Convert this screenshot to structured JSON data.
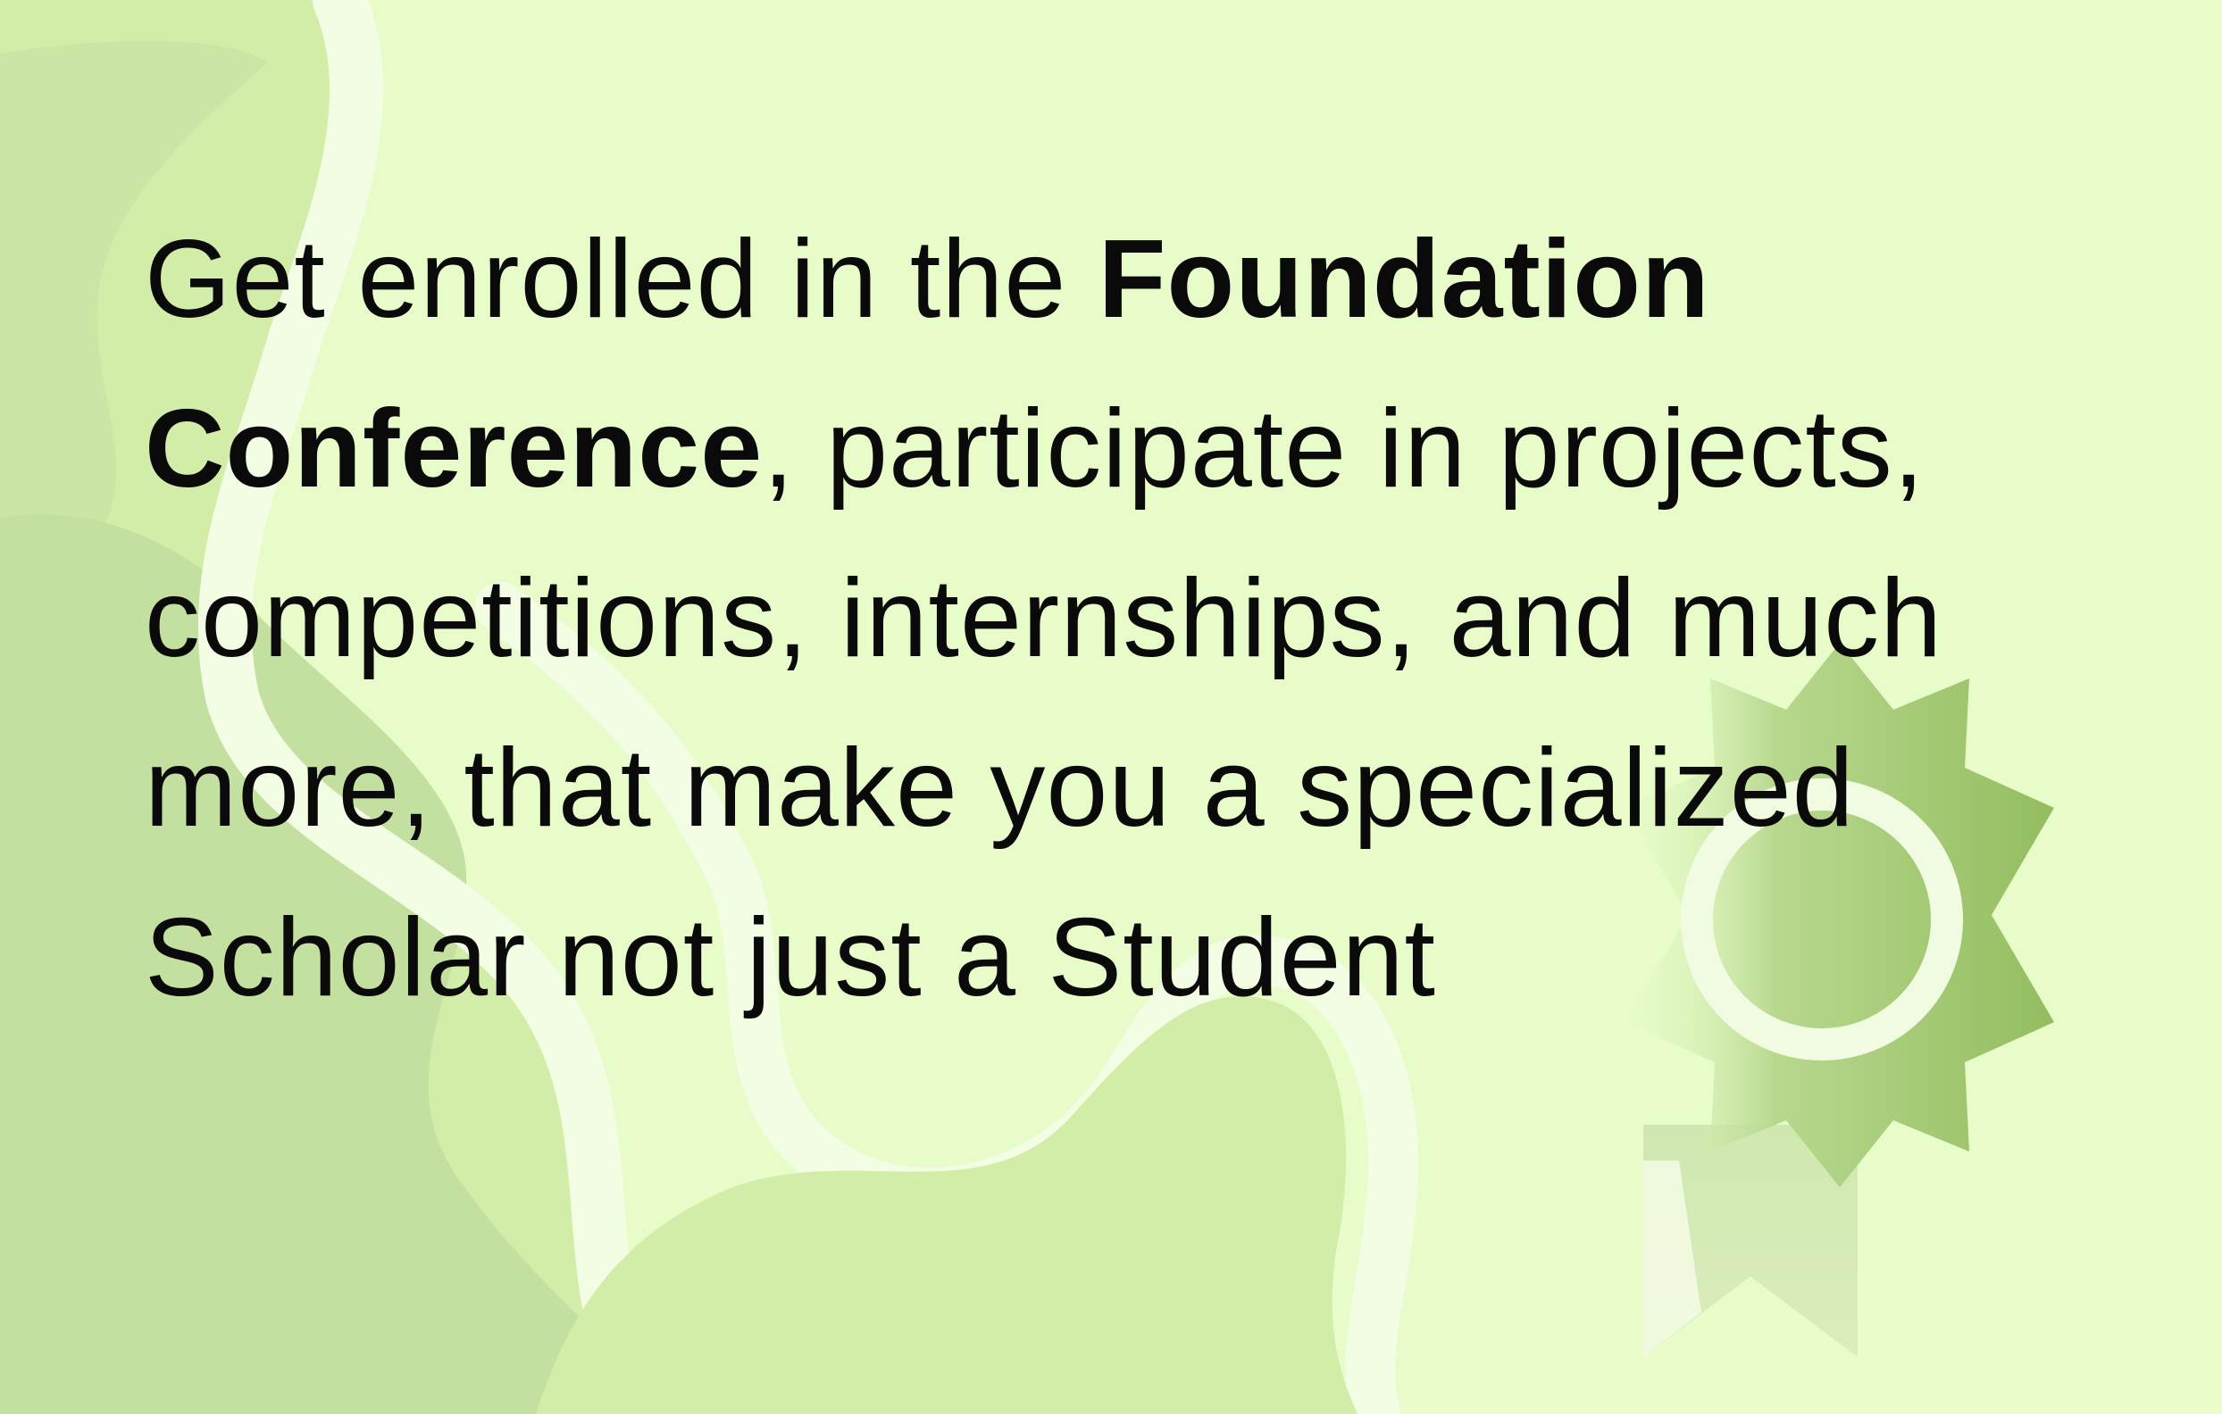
{
  "message": {
    "intro": "Get enrolled in the ",
    "highlight": "Foundation Conference",
    "body": ", participate in projects, competitions, internships, and much more, that make you a specialized Scholar not just a Student"
  },
  "colors": {
    "background": "#e7fcc9",
    "wave_light": "#d2eda8",
    "wave_dark": "#c4e0a0",
    "wave_stripe": "#f3fde3",
    "badge_green": "#9cc46a",
    "text": "#0a0a0a"
  },
  "icons": {
    "badge": "award-rosette-icon"
  }
}
